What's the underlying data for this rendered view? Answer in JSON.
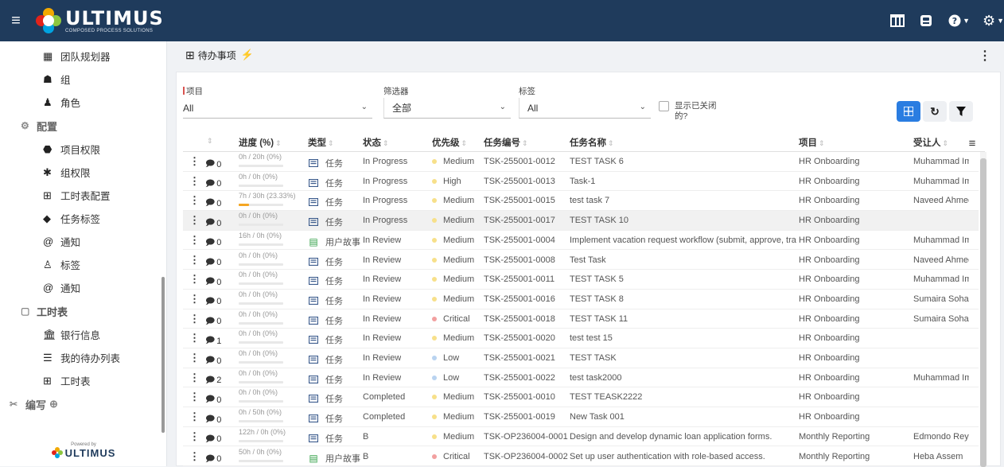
{
  "app": {
    "logo_name": "ULTIMUS",
    "logo_sub": "COMPOSED PROCESS SOLUTIONS"
  },
  "sidebar": {
    "items_top": [
      {
        "label": "团队规划器",
        "icon": "team-planner-icon"
      },
      {
        "label": "组",
        "icon": "group-icon"
      },
      {
        "label": "角色",
        "icon": "role-icon"
      }
    ],
    "section_config": "配置",
    "config_items": [
      {
        "label": "项目权限",
        "icon": "project-permission-icon"
      },
      {
        "label": "组权限",
        "icon": "group-permission-icon"
      },
      {
        "label": "工时表配置",
        "icon": "timesheet-config-icon"
      },
      {
        "label": "任务标签",
        "icon": "task-tag-icon"
      },
      {
        "label": "通知",
        "icon": "at-icon"
      },
      {
        "label": "标签",
        "icon": "label-icon"
      },
      {
        "label": "通知",
        "icon": "at-icon"
      }
    ],
    "section_timesheet": "工时表",
    "timesheet_items": [
      {
        "label": "银行信息",
        "icon": "bank-icon"
      },
      {
        "label": "我的待办列表",
        "icon": "list-icon"
      },
      {
        "label": "工时表",
        "icon": "table-icon"
      }
    ],
    "section_compose": "编写",
    "powered_by": "Powered by",
    "powered_logo": "ULTIMUS"
  },
  "page": {
    "title": "待办事项"
  },
  "filters": {
    "project_label": "项目",
    "project_value": "All",
    "filter_label": "筛选器",
    "filter_value": "全部",
    "tag_label": "标签",
    "tag_value": "All",
    "show_closed_label": "显示已关闭的?"
  },
  "table": {
    "headers": {
      "progress": "进度 (%)",
      "type": "类型",
      "status": "状态",
      "priority": "优先级",
      "code": "任务编号",
      "name": "任务名称",
      "project": "项目",
      "assignee": "受让人"
    },
    "rows": [
      {
        "comments": "0",
        "progress": "0h / 20h (0%)",
        "pct": 0,
        "type": "任务",
        "kind": "task",
        "status": "In Progress",
        "priority": "Medium",
        "code": "TSK-255001-0012",
        "name": "TEST TASK 6",
        "project": "HR Onboarding",
        "assignee": "Muhammad Im"
      },
      {
        "comments": "0",
        "progress": "0h / 0h (0%)",
        "pct": 0,
        "type": "任务",
        "kind": "task",
        "status": "In Progress",
        "priority": "High",
        "code": "TSK-255001-0013",
        "name": "Task-1",
        "project": "HR Onboarding",
        "assignee": "Muhammad Im"
      },
      {
        "comments": "0",
        "progress": "7h / 30h (23.33%)",
        "pct": 23.33,
        "type": "任务",
        "kind": "task",
        "status": "In Progress",
        "priority": "Medium",
        "code": "TSK-255001-0015",
        "name": "test task 7",
        "project": "HR Onboarding",
        "assignee": "Naveed Ahmed"
      },
      {
        "comments": "0",
        "progress": "0h / 0h (0%)",
        "pct": 0,
        "type": "任务",
        "kind": "task",
        "status": "In Progress",
        "priority": "Medium",
        "code": "TSK-255001-0017",
        "name": "TEST TASK 10",
        "project": "HR Onboarding",
        "assignee": ""
      },
      {
        "comments": "0",
        "progress": "16h / 0h (0%)",
        "pct": 0,
        "type": "用户故事",
        "kind": "story",
        "status": "In Review",
        "priority": "Medium",
        "code": "TSK-255001-0004",
        "name": "Implement vacation request workflow (submit, approve, tra",
        "project": "HR Onboarding",
        "assignee": "Muhammad Im"
      },
      {
        "comments": "0",
        "progress": "0h / 0h (0%)",
        "pct": 0,
        "type": "任务",
        "kind": "task",
        "status": "In Review",
        "priority": "Medium",
        "code": "TSK-255001-0008",
        "name": "Test Task",
        "project": "HR Onboarding",
        "assignee": "Naveed Ahmed"
      },
      {
        "comments": "0",
        "progress": "0h / 0h (0%)",
        "pct": 0,
        "type": "任务",
        "kind": "task",
        "status": "In Review",
        "priority": "Medium",
        "code": "TSK-255001-0011",
        "name": "TEST TASK 5",
        "project": "HR Onboarding",
        "assignee": "Muhammad Im"
      },
      {
        "comments": "0",
        "progress": "0h / 0h (0%)",
        "pct": 0,
        "type": "任务",
        "kind": "task",
        "status": "In Review",
        "priority": "Medium",
        "code": "TSK-255001-0016",
        "name": "TEST TASK 8",
        "project": "HR Onboarding",
        "assignee": "Sumaira Sohail"
      },
      {
        "comments": "0",
        "progress": "0h / 0h (0%)",
        "pct": 0,
        "type": "任务",
        "kind": "task",
        "status": "In Review",
        "priority": "Critical",
        "code": "TSK-255001-0018",
        "name": "TEST TASK 11",
        "project": "HR Onboarding",
        "assignee": "Sumaira Sohail"
      },
      {
        "comments": "1",
        "progress": "0h / 0h (0%)",
        "pct": 0,
        "type": "任务",
        "kind": "task",
        "status": "In Review",
        "priority": "Medium",
        "code": "TSK-255001-0020",
        "name": "test test 15",
        "project": "HR Onboarding",
        "assignee": ""
      },
      {
        "comments": "0",
        "progress": "0h / 0h (0%)",
        "pct": 0,
        "type": "任务",
        "kind": "task",
        "status": "In Review",
        "priority": "Low",
        "code": "TSK-255001-0021",
        "name": "TEST TASK",
        "project": "HR Onboarding",
        "assignee": ""
      },
      {
        "comments": "2",
        "progress": "0h / 0h (0%)",
        "pct": 0,
        "type": "任务",
        "kind": "task",
        "status": "In Review",
        "priority": "Low",
        "code": "TSK-255001-0022",
        "name": "test task2000",
        "project": "HR Onboarding",
        "assignee": "Muhammad Im"
      },
      {
        "comments": "0",
        "progress": "0h / 0h (0%)",
        "pct": 0,
        "type": "任务",
        "kind": "task",
        "status": "Completed",
        "priority": "Medium",
        "code": "TSK-255001-0010",
        "name": "TEST TEASK2222",
        "project": "HR Onboarding",
        "assignee": ""
      },
      {
        "comments": "0",
        "progress": "0h / 50h (0%)",
        "pct": 0,
        "type": "任务",
        "kind": "task",
        "status": "Completed",
        "priority": "Medium",
        "code": "TSK-255001-0019",
        "name": "New Task 001",
        "project": "HR Onboarding",
        "assignee": ""
      },
      {
        "comments": "0",
        "progress": "122h / 0h (0%)",
        "pct": 0,
        "type": "任务",
        "kind": "task",
        "status": "B",
        "priority": "Medium",
        "code": "TSK-OP236004-0001",
        "name": "Design and develop dynamic loan application forms.",
        "project": "Monthly Reporting",
        "assignee": "Edmondo Reyn"
      },
      {
        "comments": "0",
        "progress": "50h / 0h (0%)",
        "pct": 0,
        "type": "用户故事",
        "kind": "story",
        "status": "B",
        "priority": "Critical",
        "code": "TSK-OP236004-0002",
        "name": "Set up user authentication with role-based access.",
        "project": "Monthly Reporting",
        "assignee": "Heba Assem"
      }
    ],
    "highlighted_row": 3
  },
  "colors": {
    "topbar": "#1f3b5c",
    "accent": "#2a7de1",
    "medium": "#f7e08a",
    "high": "#f7e08a",
    "critical": "#f2a0a0",
    "low": "#b9d3f0",
    "progress": "#f5a623",
    "story": "#2e9e44",
    "task": "#3a5a8c"
  }
}
